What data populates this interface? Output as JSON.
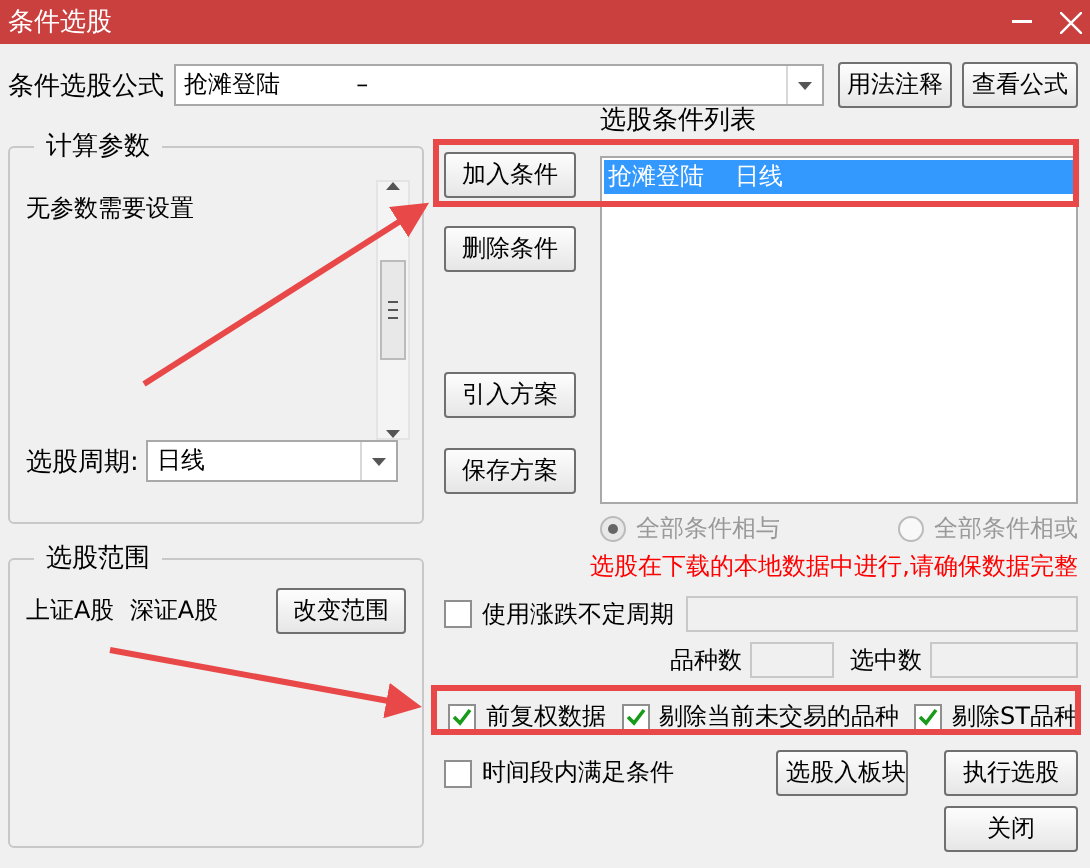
{
  "window": {
    "title": "条件选股"
  },
  "formula": {
    "label": "条件选股公式",
    "value": "抢滩登陆          –",
    "buttons": [
      "用法注释",
      "查看公式"
    ]
  },
  "params": {
    "title": "计算参数",
    "message": "无参数需要设置",
    "period_label": "选股周期:",
    "period_value": "日线"
  },
  "range": {
    "title": "选股范围",
    "markets": "上证A股  深证A股",
    "button": "改变范围"
  },
  "condition_buttons": [
    "加入条件",
    "删除条件",
    "引入方案",
    "保存方案"
  ],
  "conditions": {
    "title": "选股条件列表",
    "items": [
      {
        "text": "抢滩登陆    日线",
        "selected": true
      }
    ]
  },
  "logic": [
    {
      "label": "全部条件相与",
      "selected": true
    },
    {
      "label": "全部条件相或",
      "selected": false
    }
  ],
  "notice": "选股在下载的本地数据中进行,请确保数据完整",
  "variable_period": {
    "label": "使用涨跌不定周期",
    "checked": false
  },
  "counts": [
    {
      "label": "品种数"
    },
    {
      "label": "选中数"
    }
  ],
  "options": [
    {
      "label": "前复权数据",
      "checked": true
    },
    {
      "label": "剔除当前未交易的品种",
      "checked": true
    },
    {
      "label": "剔除ST品种",
      "checked": true
    }
  ],
  "time_condition": {
    "label": "时间段内满足条件",
    "checked": false
  },
  "actions": [
    "选股入板块",
    "执行选股",
    "关闭"
  ]
}
